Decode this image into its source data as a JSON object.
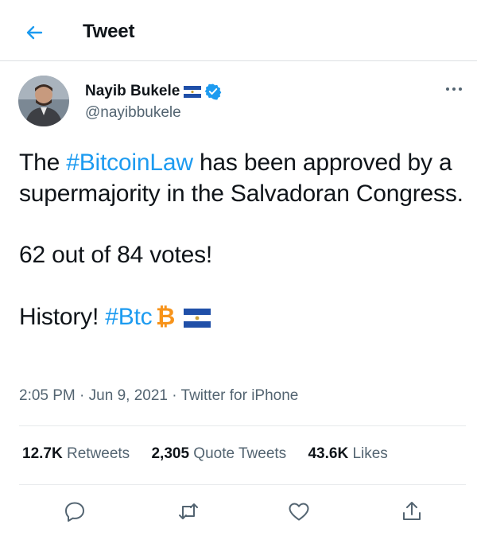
{
  "header": {
    "title": "Tweet"
  },
  "author": {
    "name": "Nayib Bukele",
    "handle": "@nayibbukele"
  },
  "tweet": {
    "line1_pre": "The ",
    "line1_tag": "#BitcoinLaw",
    "line1_post": " has been approved by a supermajority in the Salvadoran Congress.",
    "line2": "62 out of 84 votes!",
    "line3_pre": "History! ",
    "line3_tag": "#Btc"
  },
  "meta": {
    "time": "2:05 PM",
    "sep": " · ",
    "date": "Jun 9, 2021",
    "source": "Twitter for iPhone"
  },
  "stats": {
    "retweets_count": "12.7K",
    "retweets_label": "Retweets",
    "quotes_count": "2,305",
    "quotes_label": "Quote Tweets",
    "likes_count": "43.6K",
    "likes_label": "Likes"
  },
  "colors": {
    "accent": "#1d9bf0",
    "text": "#0f1419",
    "muted": "#536471",
    "bitcoin": "#f7931a",
    "flag_blue": "#1f4fa8"
  },
  "icons": [
    "back-arrow-icon",
    "flag-icon",
    "verified-icon",
    "more-icon",
    "bitcoin-icon",
    "reply-icon",
    "retweet-icon",
    "like-icon",
    "share-icon"
  ]
}
